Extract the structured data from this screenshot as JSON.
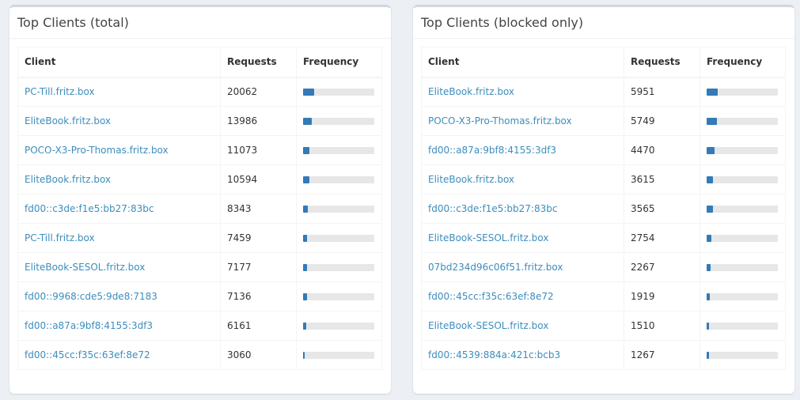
{
  "panels": [
    {
      "title": "Top Clients (total)",
      "columns": [
        "Client",
        "Requests",
        "Frequency"
      ],
      "rows": [
        {
          "client": "PC-Till.fritz.box",
          "requests": "20062",
          "frequency": 0.16
        },
        {
          "client": "EliteBook.fritz.box",
          "requests": "13986",
          "frequency": 0.12
        },
        {
          "client": "POCO-X3-Pro-Thomas.fritz.box",
          "requests": "11073",
          "frequency": 0.09
        },
        {
          "client": "EliteBook.fritz.box",
          "requests": "10594",
          "frequency": 0.085
        },
        {
          "client": "fd00::c3de:f1e5:bb27:83bc",
          "requests": "8343",
          "frequency": 0.065
        },
        {
          "client": "PC-Till.fritz.box",
          "requests": "7459",
          "frequency": 0.058
        },
        {
          "client": "EliteBook-SESOL.fritz.box",
          "requests": "7177",
          "frequency": 0.056
        },
        {
          "client": "fd00::9968:cde5:9de8:7183",
          "requests": "7136",
          "frequency": 0.056
        },
        {
          "client": "fd00::a87a:9bf8:4155:3df3",
          "requests": "6161",
          "frequency": 0.048
        },
        {
          "client": "fd00::45cc:f35c:63ef:8e72",
          "requests": "3060",
          "frequency": 0.024
        }
      ]
    },
    {
      "title": "Top Clients (blocked only)",
      "columns": [
        "Client",
        "Requests",
        "Frequency"
      ],
      "rows": [
        {
          "client": "EliteBook.fritz.box",
          "requests": "5951",
          "frequency": 0.15
        },
        {
          "client": "POCO-X3-Pro-Thomas.fritz.box",
          "requests": "5749",
          "frequency": 0.145
        },
        {
          "client": "fd00::a87a:9bf8:4155:3df3",
          "requests": "4470",
          "frequency": 0.11
        },
        {
          "client": "EliteBook.fritz.box",
          "requests": "3615",
          "frequency": 0.09
        },
        {
          "client": "fd00::c3de:f1e5:bb27:83bc",
          "requests": "3565",
          "frequency": 0.088
        },
        {
          "client": "EliteBook-SESOL.fritz.box",
          "requests": "2754",
          "frequency": 0.068
        },
        {
          "client": "07bd234d96c06f51.fritz.box",
          "requests": "2267",
          "frequency": 0.056
        },
        {
          "client": "fd00::45cc:f35c:63ef:8e72",
          "requests": "1919",
          "frequency": 0.047
        },
        {
          "client": "EliteBook-SESOL.fritz.box",
          "requests": "1510",
          "frequency": 0.037
        },
        {
          "client": "fd00::4539:884a:421c:bcb3",
          "requests": "1267",
          "frequency": 0.031
        }
      ]
    }
  ]
}
